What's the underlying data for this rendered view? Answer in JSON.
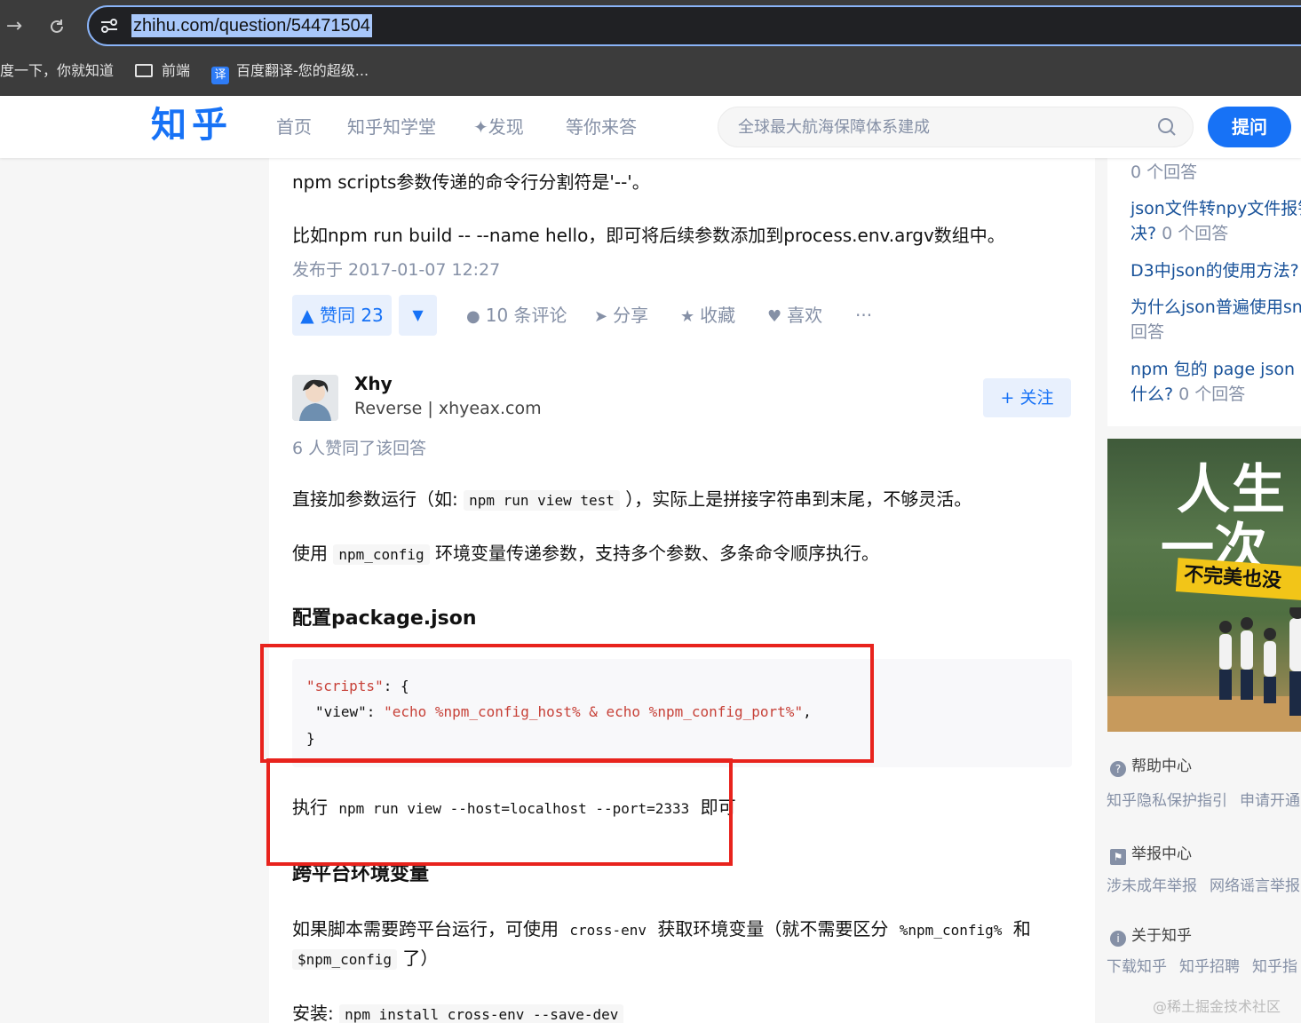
{
  "browser": {
    "url": "zhihu.com/question/54471504",
    "bookmarks": [
      {
        "label": "度一下，你就知道",
        "icon": "none"
      },
      {
        "label": "前端",
        "icon": "folder-icon"
      },
      {
        "label": "百度翻译-您的超级...",
        "icon": "fanyi-icon",
        "icon_text": "译"
      }
    ]
  },
  "header": {
    "logo": "知乎",
    "nav": [
      "首页",
      "知乎知学堂",
      "✦发现",
      "等你来答"
    ],
    "search_placeholder": "全球最大航海保障体系建成",
    "ask_label": "提问"
  },
  "answer_prev": {
    "line1": "npm scripts参数传递的命令行分割符是'--'。",
    "line2": "比如npm run build -- --name hello，即可将后续参数添加到process.env.argv数组中。",
    "posted": "发布于 2017-01-07 12:27",
    "vote_label": "▲ 赞同 23",
    "vote_down": "▼",
    "actions": {
      "comments": "10 条评论",
      "share": "分享",
      "collect": "收藏",
      "like": "喜欢",
      "more": "···"
    }
  },
  "answer": {
    "author_name": "Xhy",
    "author_bio": "Reverse | xhyeax.com",
    "follow_label": "+ 关注",
    "likes_note": "6 人赞同了该回答",
    "para1_pre": "直接加参数运行（如: ",
    "para1_code": "npm run view test",
    "para1_post": " ），实际上是拼接字符串到末尾，不够灵活。",
    "para2_pre": "使用 ",
    "para2_code": "npm_config",
    "para2_post": " 环境变量传递参数，支持多个参数、多条命令顺序执行。",
    "heading1": "配置package.json",
    "code": {
      "l1_key": "\"scripts\"",
      "l1_rest": ": {",
      "l2_key": "\"view\"",
      "l2_sep": ": ",
      "l2_val": "\"echo %npm_config_host% & echo %npm_config_port%\"",
      "l2_end": ",",
      "l3": "}"
    },
    "exec_pre": "执行 ",
    "exec_code": "npm run view --host=localhost --port=2333",
    "exec_post": " 即可",
    "heading2": "跨平台环境变量",
    "para3_pre": "如果脚本需要跨平台运行，可使用 ",
    "para3_code1": "cross-env",
    "para3_mid": " 获取环境变量（就不需要区分 ",
    "para3_code2": "%npm_config%",
    "para3_and": " 和",
    "para3_code3": "$npm_config",
    "para3_end": " 了）",
    "install_pre": "安装: ",
    "install_code": "npm install cross-env --save-dev"
  },
  "sidebar": {
    "top_count": "0 个回答",
    "related": [
      {
        "l1": "json文件转npy文件报错",
        "l2": "决?",
        "count": "0 个回答"
      },
      {
        "l1": "D3中json的使用方法?"
      },
      {
        "l1": "为什么json普遍使用snake",
        "l2": "回答"
      },
      {
        "l1": "npm 包的 page json s",
        "l2": "什么?",
        "count": "0 个回答"
      }
    ],
    "ad_text1": "人生",
    "ad_text2": "一次",
    "ad_banner": "不完美也没",
    "help_title": "帮助中心",
    "help_links": [
      "知乎隐私保护指引",
      "申请开通"
    ],
    "report_title": "举报中心",
    "report_links": [
      "涉未成年举报",
      "网络谣言举报"
    ],
    "about_title": "关于知乎",
    "about_links": [
      "下载知乎",
      "知乎招聘",
      "知乎指"
    ]
  },
  "watermark": "@稀土掘金技术社区"
}
